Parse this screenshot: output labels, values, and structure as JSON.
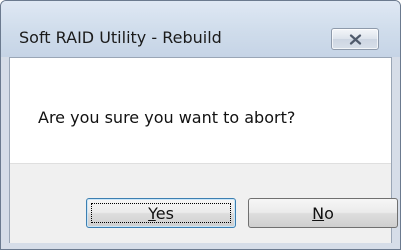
{
  "window": {
    "title": "Soft RAID Utility - Rebuild",
    "close_icon": "close-x-icon"
  },
  "dialog": {
    "message": "Are you sure you want to abort?"
  },
  "buttons": {
    "yes": {
      "mnemonic": "Y",
      "rest": "es",
      "focused": true
    },
    "no": {
      "mnemonic": "N",
      "rest": "o",
      "focused": false
    }
  },
  "colors": {
    "titlebar": "#cfdceb",
    "content_background": "#ffffff",
    "button_area_background": "#f0f0f0",
    "focus_border": "#3c7fb1"
  }
}
